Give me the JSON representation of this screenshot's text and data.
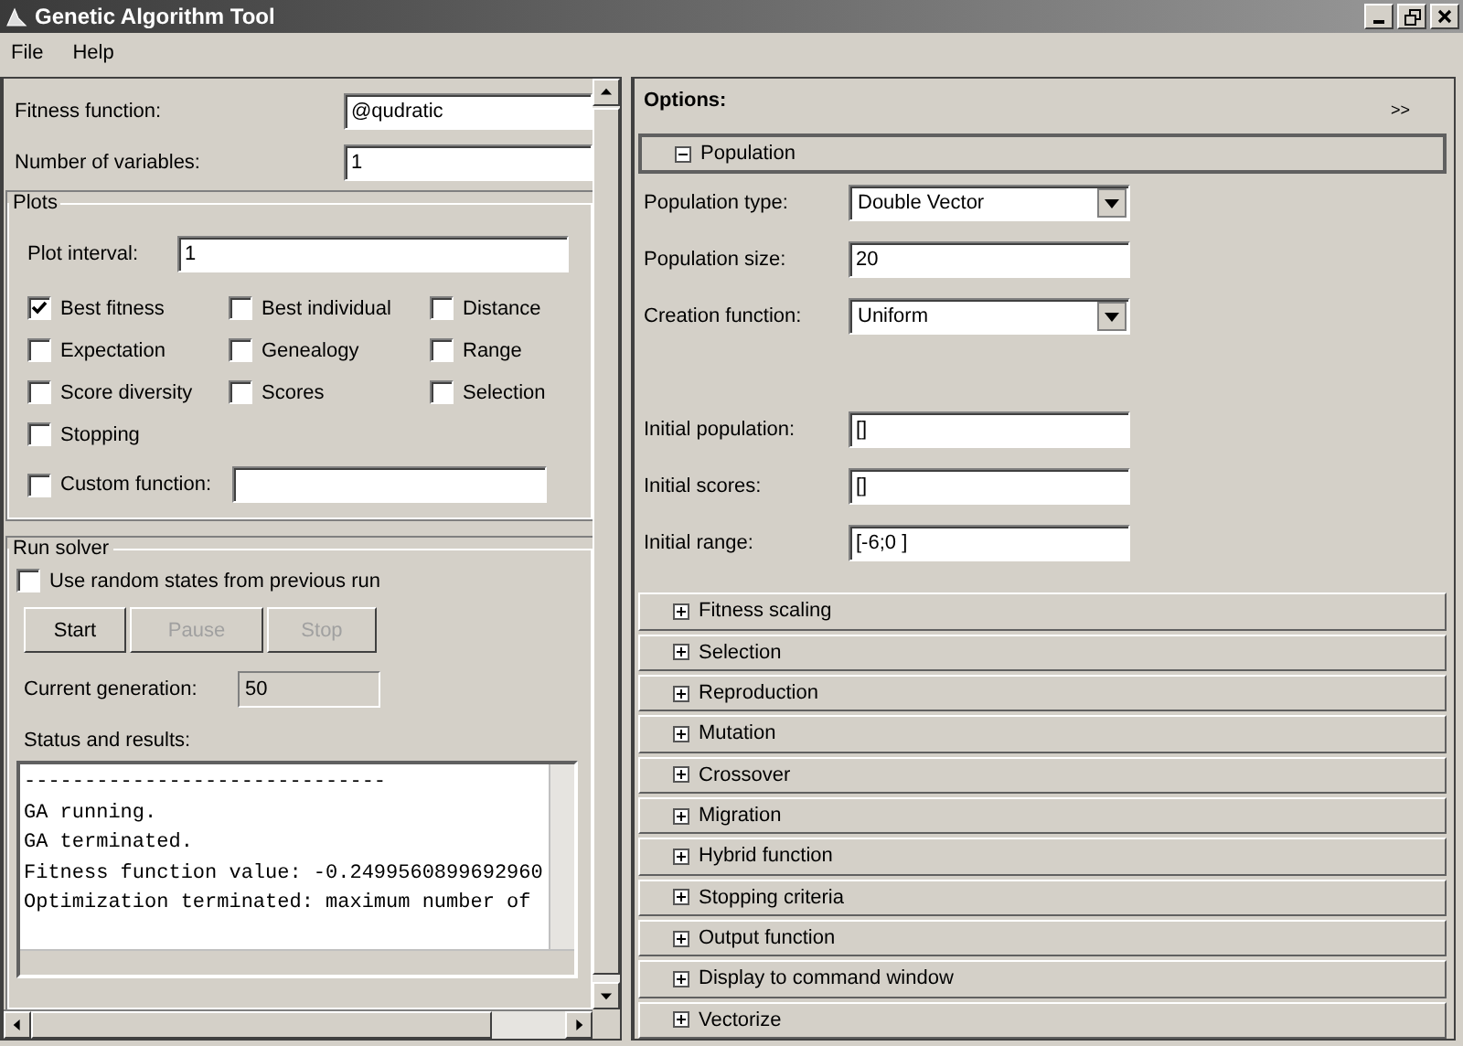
{
  "window": {
    "title": "Genetic Algorithm Tool"
  },
  "menu": [
    "File",
    "Help"
  ],
  "problem": [
    {
      "label": "Fitness function:",
      "value": "@qudratic"
    },
    {
      "label": "Number of variables:",
      "value": "1"
    }
  ],
  "plots": {
    "title": "Plots",
    "plot_interval": {
      "label": "Plot interval:",
      "value": "1"
    },
    "checkboxes": [
      {
        "label": "Best fitness",
        "checked": true
      },
      {
        "label": "Best individual",
        "checked": false
      },
      {
        "label": "Distance",
        "checked": false
      },
      {
        "label": "Expectation",
        "checked": false
      },
      {
        "label": "Genealogy",
        "checked": false
      },
      {
        "label": "Range",
        "checked": false
      },
      {
        "label": "Score diversity",
        "checked": false
      },
      {
        "label": "Scores",
        "checked": false
      },
      {
        "label": "Selection",
        "checked": false
      },
      {
        "label": "Stopping",
        "checked": false
      }
    ],
    "custom_function": {
      "label": "Custom function:",
      "checked": false
    }
  },
  "run_solver": {
    "title": "Run solver",
    "use_random_states": {
      "label": "Use random states from previous run",
      "checked": false
    },
    "buttons": [
      {
        "label": "Start",
        "disabled": false
      },
      {
        "label": "Pause",
        "disabled": true
      },
      {
        "label": "Stop",
        "disabled": true
      }
    ],
    "current_generation": {
      "label": "Current generation:",
      "value": "50"
    },
    "status_label": "Status and results:",
    "status_lines": [
      "------------------------------",
      "GA running.",
      "GA terminated.",
      "Fitness function value: -0.2499560899692960",
      "Optimization terminated: maximum number of"
    ]
  },
  "options": {
    "title": "Options:",
    "expand_label": ">>",
    "sections": [
      {
        "label": "Population",
        "expanded": true,
        "fields": [
          {
            "kind": "dropdown",
            "label": "Population type:",
            "value": "Double Vector"
          },
          {
            "kind": "text",
            "label": "Population size:",
            "value": "20"
          },
          {
            "kind": "dropdown",
            "label": "Creation function:",
            "value": "Uniform"
          }
        ],
        "more_fields": [
          {
            "kind": "text",
            "label": "Initial population:",
            "value": "[]"
          },
          {
            "kind": "text",
            "label": "Initial scores:",
            "value": "[]"
          },
          {
            "kind": "text",
            "label": "Initial range:",
            "value": "[-6;0 ]"
          }
        ]
      },
      {
        "label": "Fitness scaling",
        "expanded": false
      },
      {
        "label": "Selection",
        "expanded": false
      },
      {
        "label": "Reproduction",
        "expanded": false
      },
      {
        "label": "Mutation",
        "expanded": false
      },
      {
        "label": "Crossover",
        "expanded": false
      },
      {
        "label": "Migration",
        "expanded": false
      },
      {
        "label": "Hybrid function",
        "expanded": false
      },
      {
        "label": "Stopping criteria",
        "expanded": false
      },
      {
        "label": "Output function",
        "expanded": false
      },
      {
        "label": "Display to command window",
        "expanded": false
      },
      {
        "label": "Vectorize",
        "expanded": false
      }
    ]
  }
}
